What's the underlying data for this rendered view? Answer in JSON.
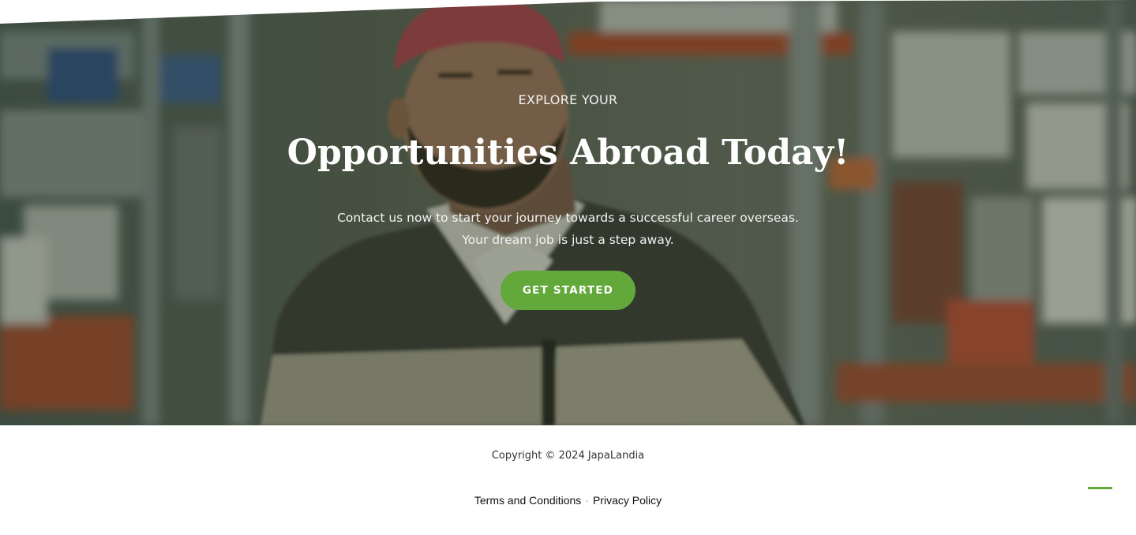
{
  "hero": {
    "eyebrow": "EXPLORE YOUR",
    "headline": "Opportunities Abroad Today!",
    "subtext_line1": "Contact us now to start your journey towards a successful career overseas.",
    "subtext_line2": "Your dream job is just a step away.",
    "cta_label": "GET STARTED"
  },
  "footer": {
    "copyright": "Copyright © 2024 JapaLandia",
    "links": {
      "terms": "Terms and Conditions",
      "separator": "·",
      "privacy": "Privacy Policy"
    }
  },
  "colors": {
    "accent": "#62a83a",
    "hero_overlay": "#28341e",
    "footer_bg": "#ffffff"
  },
  "icons": {
    "scroll_top": "scroll-to-top-icon"
  }
}
